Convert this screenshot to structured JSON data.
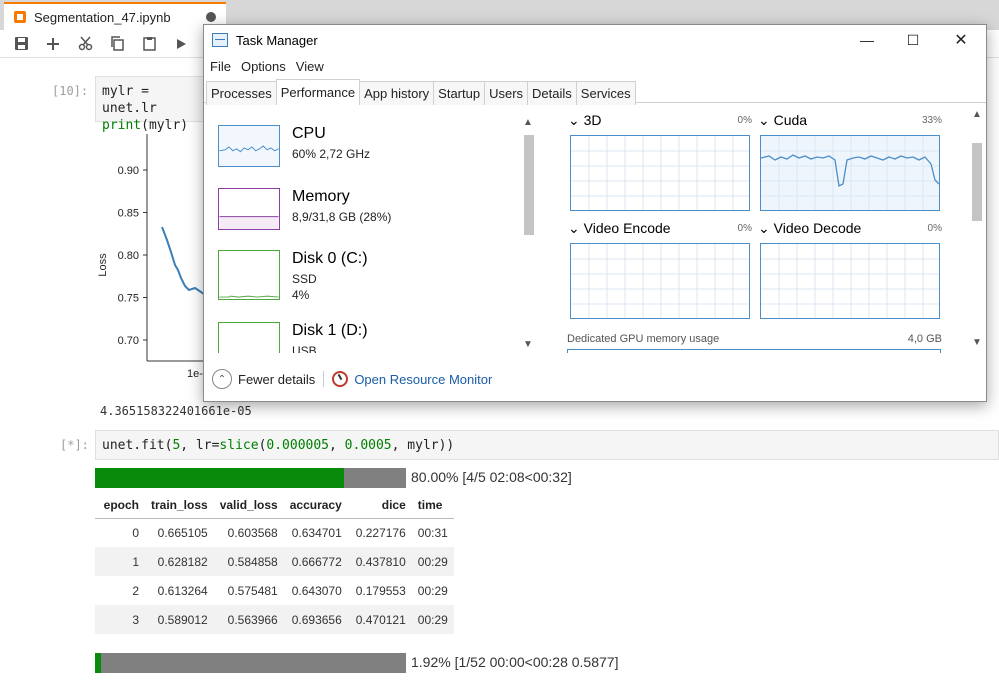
{
  "notebook": {
    "tab_title": "Segmentation_47.ipynb",
    "cell1": {
      "prompt": "[10]:",
      "line1_a": "mylr = unet.",
      "line1_b": "lr",
      "line2_fn": "print",
      "line2_rest": "(mylr)"
    },
    "plot": {
      "ylabel": "Loss",
      "yticks": [
        "0.90",
        "0.85",
        "0.80",
        "0.75",
        "0.70"
      ],
      "xtick_partial": "1e-"
    },
    "cell1_output": "4.365158322401661e-05",
    "cell2": {
      "prompt": "[*]:",
      "code_a": "unet.fit(",
      "code_n1": "5",
      "code_b": ", lr=",
      "code_fn": "slice",
      "code_c": "(",
      "code_n2": "0.000005",
      "code_d": ", ",
      "code_n3": "0.0005",
      "code_e": ", mylr))"
    },
    "progress_epochs": {
      "fraction": 0.8,
      "text": "80.00% [4/5 02:08<00:32]"
    },
    "progress_batches": {
      "fraction": 0.0192,
      "text": "1.92% [1/52 00:00<00:28 0.5877]"
    },
    "results": {
      "headers": [
        "epoch",
        "train_loss",
        "valid_loss",
        "accuracy",
        "dice",
        "time"
      ],
      "rows": [
        [
          "0",
          "0.665105",
          "0.603568",
          "0.634701",
          "0.227176",
          "00:31"
        ],
        [
          "1",
          "0.628182",
          "0.584858",
          "0.666772",
          "0.437810",
          "00:29"
        ],
        [
          "2",
          "0.613264",
          "0.575481",
          "0.643070",
          "0.179553",
          "00:29"
        ],
        [
          "3",
          "0.589012",
          "0.563966",
          "0.693656",
          "0.470121",
          "00:29"
        ]
      ]
    }
  },
  "task_manager": {
    "title": "Task Manager",
    "window_buttons": {
      "minimize": "—",
      "maximize": "☐",
      "close": "✕"
    },
    "menu": [
      "File",
      "Options",
      "View"
    ],
    "tabs": [
      "Processes",
      "Performance",
      "App history",
      "Startup",
      "Users",
      "Details",
      "Services"
    ],
    "active_tab": "Performance",
    "resources": [
      {
        "name": "CPU",
        "sub1": "60%  2,72 GHz",
        "sub2": "",
        "color": "#4b8ec9"
      },
      {
        "name": "Memory",
        "sub1": "8,9/31,8 GB (28%)",
        "sub2": "",
        "color": "#8b3fa3"
      },
      {
        "name": "Disk 0 (C:)",
        "sub1": "SSD",
        "sub2": "4%",
        "color": "#4fa83d"
      },
      {
        "name": "Disk 1 (D:)",
        "sub1": "USB",
        "sub2": "",
        "color": "#4fa83d"
      }
    ],
    "gpu_engines": [
      {
        "name": "3D",
        "pct": "0%"
      },
      {
        "name": "Cuda",
        "pct": "33%"
      },
      {
        "name": "Video Encode",
        "pct": "0%"
      },
      {
        "name": "Video Decode",
        "pct": "0%"
      }
    ],
    "dedicated_label": "Dedicated GPU memory usage",
    "dedicated_max": "4,0 GB",
    "footer": {
      "fewer_details": "Fewer details",
      "open_monitor": "Open Resource Monitor"
    }
  }
}
